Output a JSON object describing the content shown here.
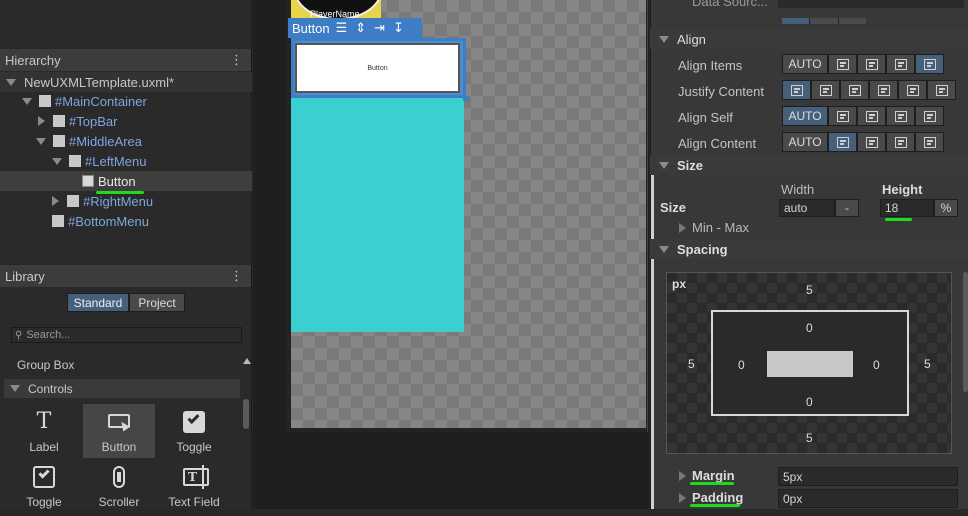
{
  "hierarchy": {
    "title": "Hierarchy",
    "root": "NewUXMLTemplate.uxml*",
    "items": [
      "#MainContainer",
      "#TopBar",
      "#MiddleArea",
      "#LeftMenu",
      "Button",
      "#RightMenu",
      "#BottomMenu"
    ]
  },
  "library": {
    "title": "Library",
    "tabs": [
      "Standard",
      "Project"
    ],
    "search_placeholder": "Search...",
    "group_box": "Group Box",
    "controls_label": "Controls",
    "tiles": [
      "Label",
      "Button",
      "Toggle",
      "Toggle",
      "Scroller",
      "Text Field"
    ]
  },
  "canvas": {
    "player_name": "PlayerName",
    "toolbar_label": "Button",
    "button_text": "Button"
  },
  "inspector": {
    "data_source": "Data Sourc...",
    "align": {
      "title": "Align",
      "rows": [
        "Align Items",
        "Justify Content",
        "Align Self",
        "Align Content"
      ],
      "auto": "AUTO"
    },
    "size": {
      "title": "Size",
      "label": "Size",
      "width_label": "Width",
      "height_label": "Height",
      "width_value": "auto",
      "width_unit": "-",
      "height_value": "18",
      "height_unit": "%",
      "min_max": "Min - Max"
    },
    "spacing": {
      "title": "Spacing",
      "unit": "px",
      "margin_top": "5",
      "margin_left": "5",
      "margin_right": "5",
      "margin_bottom": "5",
      "pad_top": "0",
      "pad_left": "0",
      "pad_right": "0",
      "pad_bottom": "0",
      "margin_label": "Margin",
      "margin_value": "5px",
      "padding_label": "Padding",
      "padding_value": "0px"
    }
  },
  "colors": {
    "accent": "#46607c",
    "highlight": "#1fdb1f",
    "cyan": "#3ccfcf"
  }
}
